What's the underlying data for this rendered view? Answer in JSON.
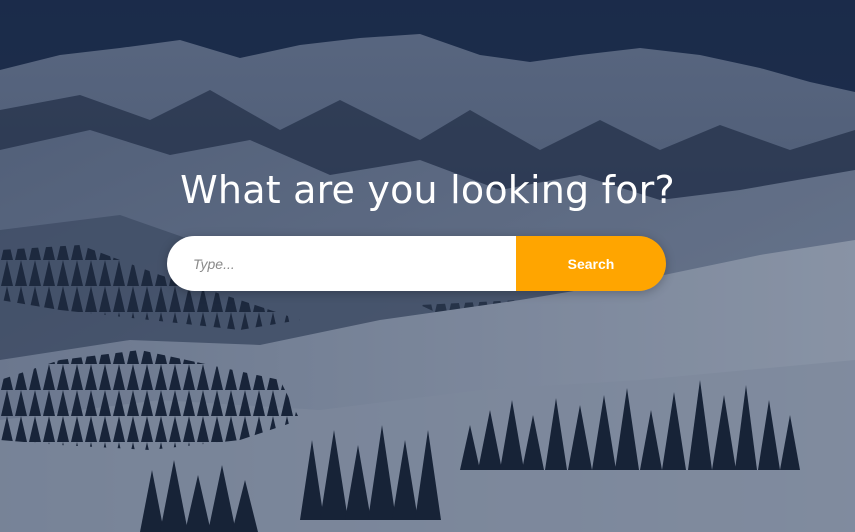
{
  "hero": {
    "headline": "What are you looking for?"
  },
  "search": {
    "placeholder": "Type...",
    "button_label": "Search"
  },
  "colors": {
    "accent": "#FFA500",
    "overlay": "#1c2a44",
    "text": "#FFFFFF"
  },
  "background": {
    "subject": "snowy-mountain-landscape"
  }
}
